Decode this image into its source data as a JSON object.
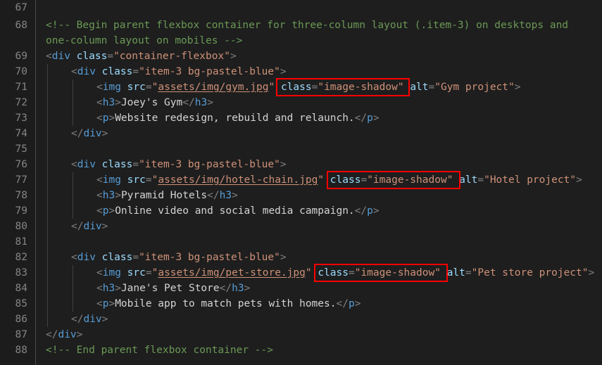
{
  "editor": {
    "language": "html",
    "theme": "dark",
    "colors": {
      "background": "#1E1E1E",
      "gutter_background": "#1C1C1C",
      "line_number": "#858585",
      "punctuation": "#808080",
      "tag": "#569CD6",
      "attribute": "#9CDCFE",
      "string": "#CE9178",
      "comment": "#6A9955",
      "text": "#D4D4D4",
      "indent_guide": "#404040",
      "annotation": "#FF0000"
    },
    "first_line": 67,
    "last_line": 89
  },
  "line_numbers": {
    "l67": "67",
    "l68": "68",
    "l69": "69",
    "l70": "70",
    "l71": "71",
    "l72": "72",
    "l73": "73",
    "l74": "74",
    "l75": "75",
    "l76": "76",
    "l77": "77",
    "l78": "78",
    "l79": "79",
    "l80": "80",
    "l81": "81",
    "l82": "82",
    "l83": "83",
    "l84": "84",
    "l85": "85",
    "l86": "86",
    "l87": "87",
    "l88": "88"
  },
  "code": {
    "comment_open_a": "<!-- Begin parent flexbox container for three-column layout (.item-3) on desktops and",
    "comment_open_b": "one-column layout on mobiles -->",
    "comment_close": "<!-- End parent flexbox container -->",
    "container_class": "container-flexbox",
    "item_class": "item-3 bg-pastel-blue",
    "img_class": "image-shadow",
    "blocks": [
      {
        "src": "assets/img/gym.jpg",
        "alt": "Gym project",
        "heading": "Joey's Gym",
        "paragraph": "Website redesign, rebuild and relaunch."
      },
      {
        "src": "assets/img/hotel-chain.jpg",
        "alt": "Hotel project",
        "heading": "Pyramid Hotels",
        "paragraph": "Online video and social media campaign."
      },
      {
        "src": "assets/img/pet-store.jpg",
        "alt": "Pet store project",
        "heading": "Jane's Pet Store",
        "paragraph": "Mobile app to match pets with homes."
      }
    ],
    "tokens": {
      "lt": "<",
      "gt": ">",
      "lt_slash": "</",
      "div": "div",
      "img": "img",
      "h3": "h3",
      "p": "p",
      "class_attr": "class",
      "src_attr": "src",
      "alt_attr": "alt",
      "eq_quote": "=\"",
      "quote": "\""
    }
  },
  "annotations": {
    "highlight_label": "class=\"image-shadow\"",
    "count": 3,
    "boxes": [
      {
        "target_line": "71",
        "text": "class=\"image-shadow\""
      },
      {
        "target_line": "77",
        "text": "class=\"image-shadow\""
      },
      {
        "target_line": "83",
        "text": "class=\"image-shadow\""
      }
    ]
  }
}
